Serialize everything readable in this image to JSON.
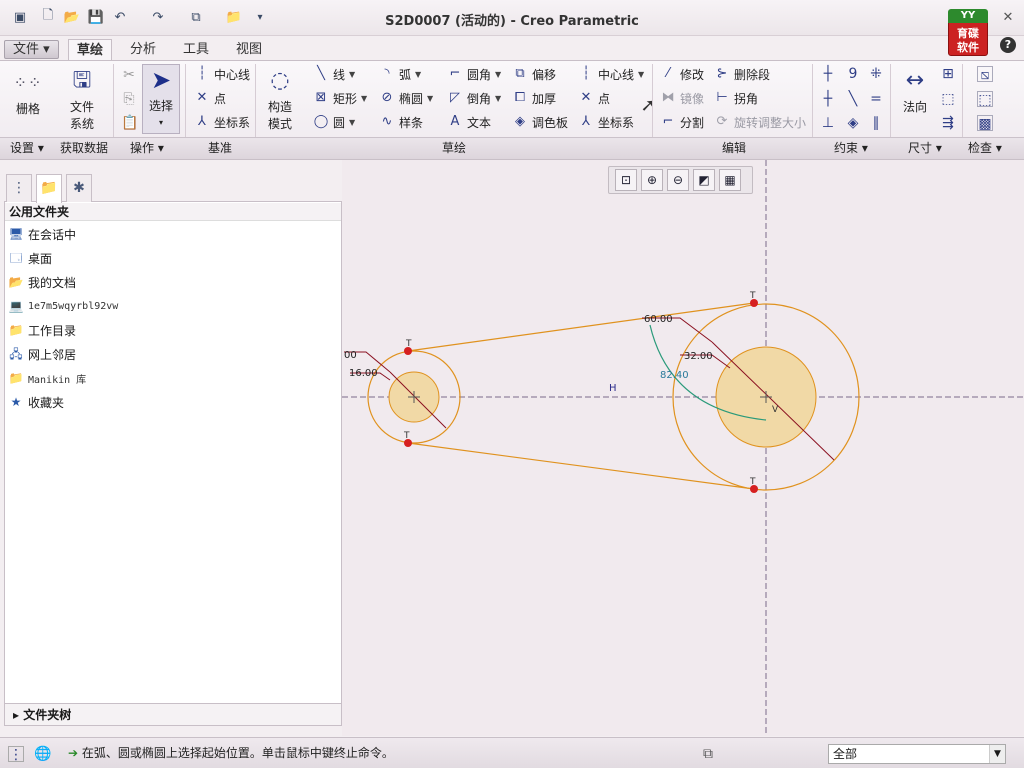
{
  "window": {
    "title": "S2D0007 (活动的) - Creo Parametric"
  },
  "brand": {
    "line1": "育碟",
    "line2": "软件"
  },
  "help": "?",
  "menu": {
    "file": "文件",
    "tabs": [
      "草绘",
      "分析",
      "工具",
      "视图"
    ],
    "active_tab": "草绘"
  },
  "ribbon": {
    "setup": {
      "grid": "栅格",
      "group": "设置"
    },
    "get_data": {
      "file_system": [
        "文件",
        "系统"
      ],
      "group": "获取数据"
    },
    "operations": {
      "select": "选择",
      "group": "操作"
    },
    "datum": {
      "centerline": "中心线",
      "point": "点",
      "coord_sys": "坐标系",
      "group": "基准"
    },
    "construct": {
      "label": [
        "构造",
        "模式"
      ]
    },
    "sketch": {
      "line": "线",
      "arc": "弧",
      "fillet": "圆角",
      "offset": "偏移",
      "rectangle": "矩形",
      "ellipse": "椭圆",
      "chamfer": "倒角",
      "thicken": "加厚",
      "circle": "圆",
      "spline": "样条",
      "text": "文本",
      "palette": "调色板",
      "centerline": "中心线",
      "point": "点",
      "coord_sys": "坐标系",
      "group": "草绘"
    },
    "edit": {
      "modify": "修改",
      "delete_segment": "删除段",
      "mirror": "镜像",
      "corner": "拐角",
      "divide": "分割",
      "rotate_resize": "旋转调整大小",
      "group": "编辑"
    },
    "constrain": {
      "group": "约束"
    },
    "dimension": {
      "normal": "法向",
      "group": "尺寸"
    },
    "inspect": {
      "group": "检查"
    }
  },
  "panel": {
    "header": "公用文件夹",
    "items": [
      {
        "label": "在会话中",
        "icon": "session-icon"
      },
      {
        "label": "桌面",
        "icon": "desktop-icon"
      },
      {
        "label": "我的文档",
        "icon": "documents-icon"
      },
      {
        "label": "1e7m5wqyrbl92vw",
        "icon": "computer-icon"
      },
      {
        "label": "工作目录",
        "icon": "working-dir-icon"
      },
      {
        "label": "网上邻居",
        "icon": "network-icon"
      },
      {
        "label": "Manikin 库",
        "icon": "manikin-icon"
      },
      {
        "label": "收藏夹",
        "icon": "favorites-icon"
      }
    ],
    "folder_tree": "文件夹树"
  },
  "sketch": {
    "dims": {
      "d_left_partial": "00",
      "d_left": "16.00",
      "d_right_outer": "60.00",
      "d_right_inner": "32.00",
      "angle": "82.40"
    },
    "labels": {
      "horizontal": "H",
      "tangent": "T",
      "vertical": "V"
    },
    "colors": {
      "geometry": "#e0921e",
      "dimension": "#8a1020",
      "fill": "#f1d9a6",
      "tangent_point": "#d62020",
      "centerline": "#7b6a8a",
      "angle_arc": "#2a9a7a"
    }
  },
  "status": {
    "message": "在弧、圆或椭圆上选择起始位置。单击鼠标中键终止命令。",
    "filter": "全部"
  }
}
